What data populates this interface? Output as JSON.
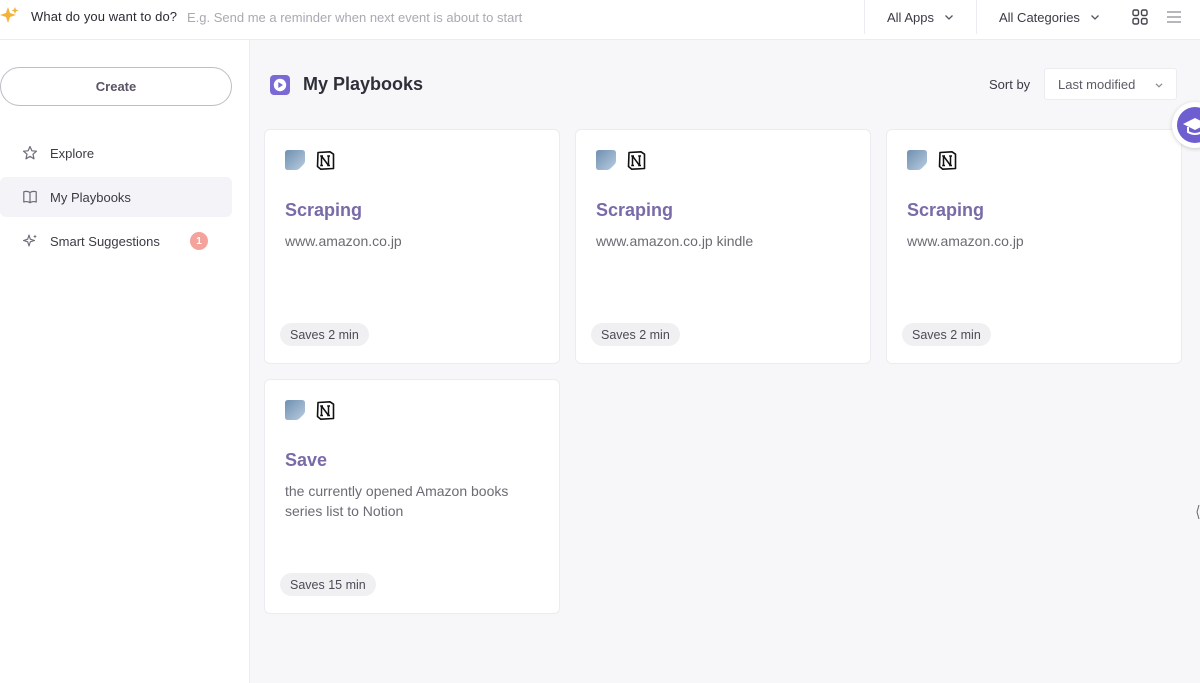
{
  "topbar": {
    "prompt_label": "What do you want to do?",
    "prompt_placeholder": "E.g. Send me a reminder when next event is about to start",
    "apps_filter": "All Apps",
    "categories_filter": "All Categories"
  },
  "sidebar": {
    "create_label": "Create",
    "items": [
      {
        "label": "Explore",
        "icon": "star-icon"
      },
      {
        "label": "My Playbooks",
        "icon": "book-icon",
        "active": true
      },
      {
        "label": "Smart Suggestions",
        "icon": "sparkle-icon",
        "badge": "1"
      }
    ]
  },
  "main": {
    "title": "My Playbooks",
    "sort_label": "Sort by",
    "sort_value": "Last modified",
    "cards": [
      {
        "title": "Scraping",
        "description": "www.amazon.co.jp",
        "saves": "Saves 2 min",
        "apps": [
          "web-app-icon",
          "notion-icon"
        ]
      },
      {
        "title": "Scraping",
        "description": "www.amazon.co.jp kindle",
        "saves": "Saves 2 min",
        "apps": [
          "web-app-icon",
          "notion-icon"
        ]
      },
      {
        "title": "Scraping",
        "description": "www.amazon.co.jp",
        "saves": "Saves 2 min",
        "apps": [
          "web-app-icon",
          "notion-icon"
        ]
      },
      {
        "title": "Save",
        "description": "the currently opened Amazon books series list to Notion",
        "saves": "Saves 15 min",
        "apps": [
          "web-app-icon",
          "notion-icon"
        ]
      }
    ]
  },
  "colors": {
    "accent": "#6d5fd0",
    "card_title": "#7a6aa8",
    "badge": "#f3a39c",
    "background": "#f7f7fa"
  }
}
